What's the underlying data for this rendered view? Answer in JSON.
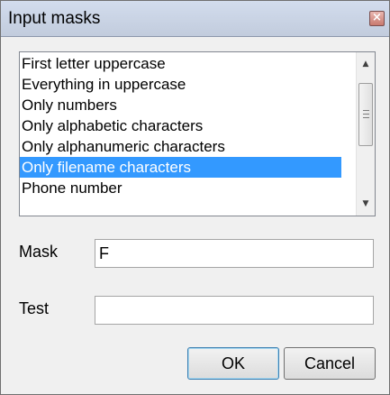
{
  "window": {
    "title": "Input masks",
    "close_glyph": "×"
  },
  "masks_list": {
    "items": [
      "First letter uppercase",
      "Everything in uppercase",
      "Only numbers",
      "Only alphabetic characters",
      "Only alphanumeric characters",
      "Only filename characters",
      "Phone number"
    ],
    "selected_index": 5
  },
  "form": {
    "mask_label": "Mask",
    "mask_value": "F",
    "test_label": "Test",
    "test_value": ""
  },
  "buttons": {
    "ok": "OK",
    "cancel": "Cancel"
  }
}
